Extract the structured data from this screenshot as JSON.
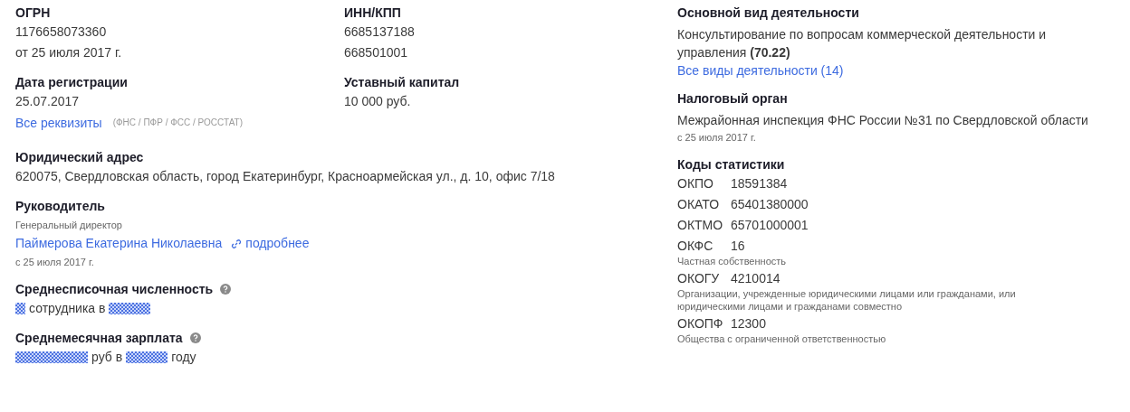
{
  "ogrn": {
    "heading": "ОГРН",
    "value": "1176658073360",
    "date": "от 25 июля 2017 г."
  },
  "inn_kpp": {
    "heading": "ИНН/КПП",
    "values": [
      "6685137188",
      "668501001"
    ]
  },
  "registration_date": {
    "heading": "Дата регистрации",
    "value": "25.07.2017"
  },
  "authorized_capital": {
    "heading": "Уставный капитал",
    "value": "10 000 руб."
  },
  "all_details": {
    "link": "Все реквизиты",
    "note": "(ФНС / ПФР / ФСС / РОССТАТ)"
  },
  "legal_address": {
    "heading": "Юридический адрес",
    "value": "620075, Свердловская область, город Екатеринбург, Красноармейская ул., д. 10, офис 7/18"
  },
  "director": {
    "heading": "Руководитель",
    "position": "Генеральный директор",
    "name": "Паймерова Екатерина Николаевна",
    "more_link": "подробнее",
    "since": "с 25 июля 2017 г."
  },
  "headcount": {
    "heading": "Среднесписочная численность",
    "parts": [
      {
        "kind": "tinymask"
      },
      {
        "kind": "text",
        "text": "сотрудника в"
      },
      {
        "kind": "mask"
      }
    ]
  },
  "salary": {
    "heading": "Среднемесячная зарплата",
    "parts": [
      {
        "kind": "widemask"
      },
      {
        "kind": "text",
        "text": "руб в"
      },
      {
        "kind": "mask"
      },
      {
        "kind": "text",
        "text": "году"
      }
    ]
  },
  "main_activity": {
    "heading": "Основной вид деятельности",
    "text": "Консультирование по вопросам коммерческой деятельности и управления **(70.22)**",
    "link": "Все виды деятельности (14)"
  },
  "tax_authority": {
    "heading": "Налоговый орган",
    "value": "Межрайонная инспекция ФНС России №31 по Свердловской области",
    "since": "с 25 июля 2017 г."
  },
  "statistics_codes": {
    "heading": "Коды статистики",
    "codes": [
      {
        "code": "ОКПО",
        "value": "18591384"
      },
      {
        "code": "ОКАТО",
        "value": "65401380000"
      },
      {
        "code": "ОКТМО",
        "value": "65701000001"
      },
      {
        "code": "ОКФС",
        "value": "16",
        "description": "Частная собственность"
      },
      {
        "code": "ОКОГУ",
        "value": "4210014",
        "description": "Организации, учрежденные юридическими лицами или гражданами, или юридическими лицами и гражданами совместно"
      },
      {
        "code": "ОКОПФ",
        "value": "12300",
        "description": "Общества с ограниченной ответственностью"
      }
    ]
  }
}
